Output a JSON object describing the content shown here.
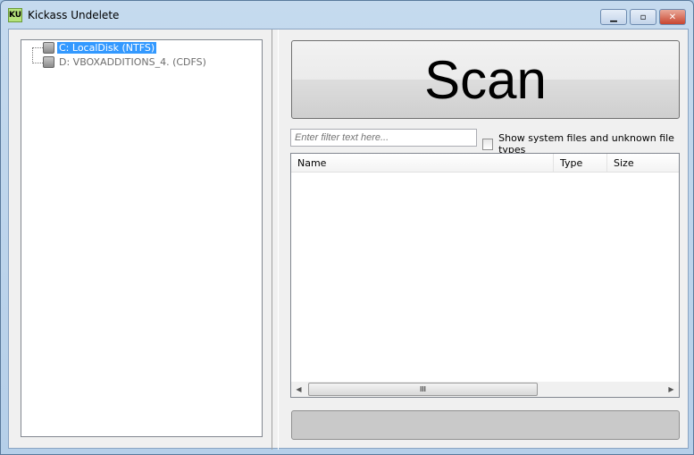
{
  "window": {
    "title": "Kickass Undelete",
    "logo": "KU"
  },
  "controls": {
    "minimize": "▁",
    "maximize": "▫",
    "close": "✕"
  },
  "tree": {
    "items": [
      {
        "label": "C: LocalDisk (NTFS)",
        "selected": true
      },
      {
        "label": "D: VBOXADDITIONS_4. (CDFS)",
        "selected": false
      }
    ]
  },
  "scan_label": "Scan",
  "filter": {
    "placeholder": "Enter filter text here...",
    "value": ""
  },
  "show_system": {
    "label": "Show system files and unknown file types",
    "checked": false
  },
  "list": {
    "columns": [
      "Name",
      "Type",
      "Size"
    ],
    "rows": []
  },
  "scrollbar": {
    "grip": "III",
    "left": "◀",
    "right": "▶"
  },
  "progress": {
    "percent": 0
  }
}
